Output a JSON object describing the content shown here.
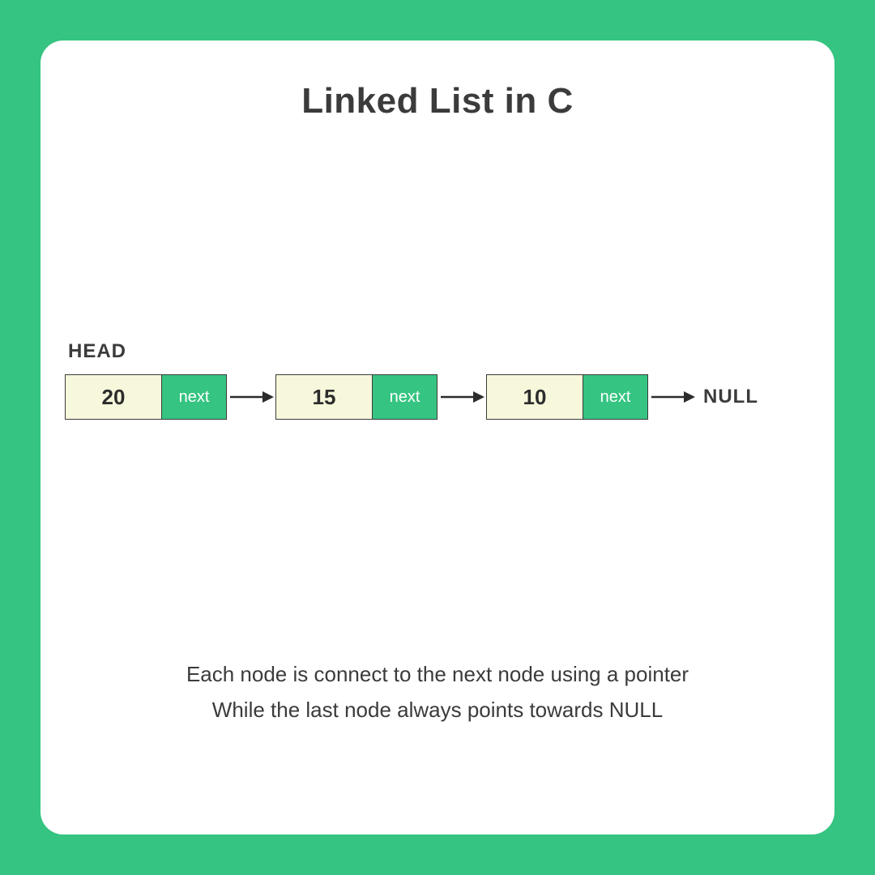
{
  "title": "Linked List in C",
  "diagram": {
    "head_label": "HEAD",
    "null_label": "NULL",
    "pointer_label": "next",
    "nodes": [
      {
        "value": "20"
      },
      {
        "value": "15"
      },
      {
        "value": "10"
      }
    ]
  },
  "caption": {
    "line1": "Each node is connect to the next node using a pointer",
    "line2": "While the last node always points towards NULL"
  },
  "colors": {
    "accent": "#35c481",
    "node_fill": "#f7f7dc",
    "text": "#3b3b3b"
  }
}
